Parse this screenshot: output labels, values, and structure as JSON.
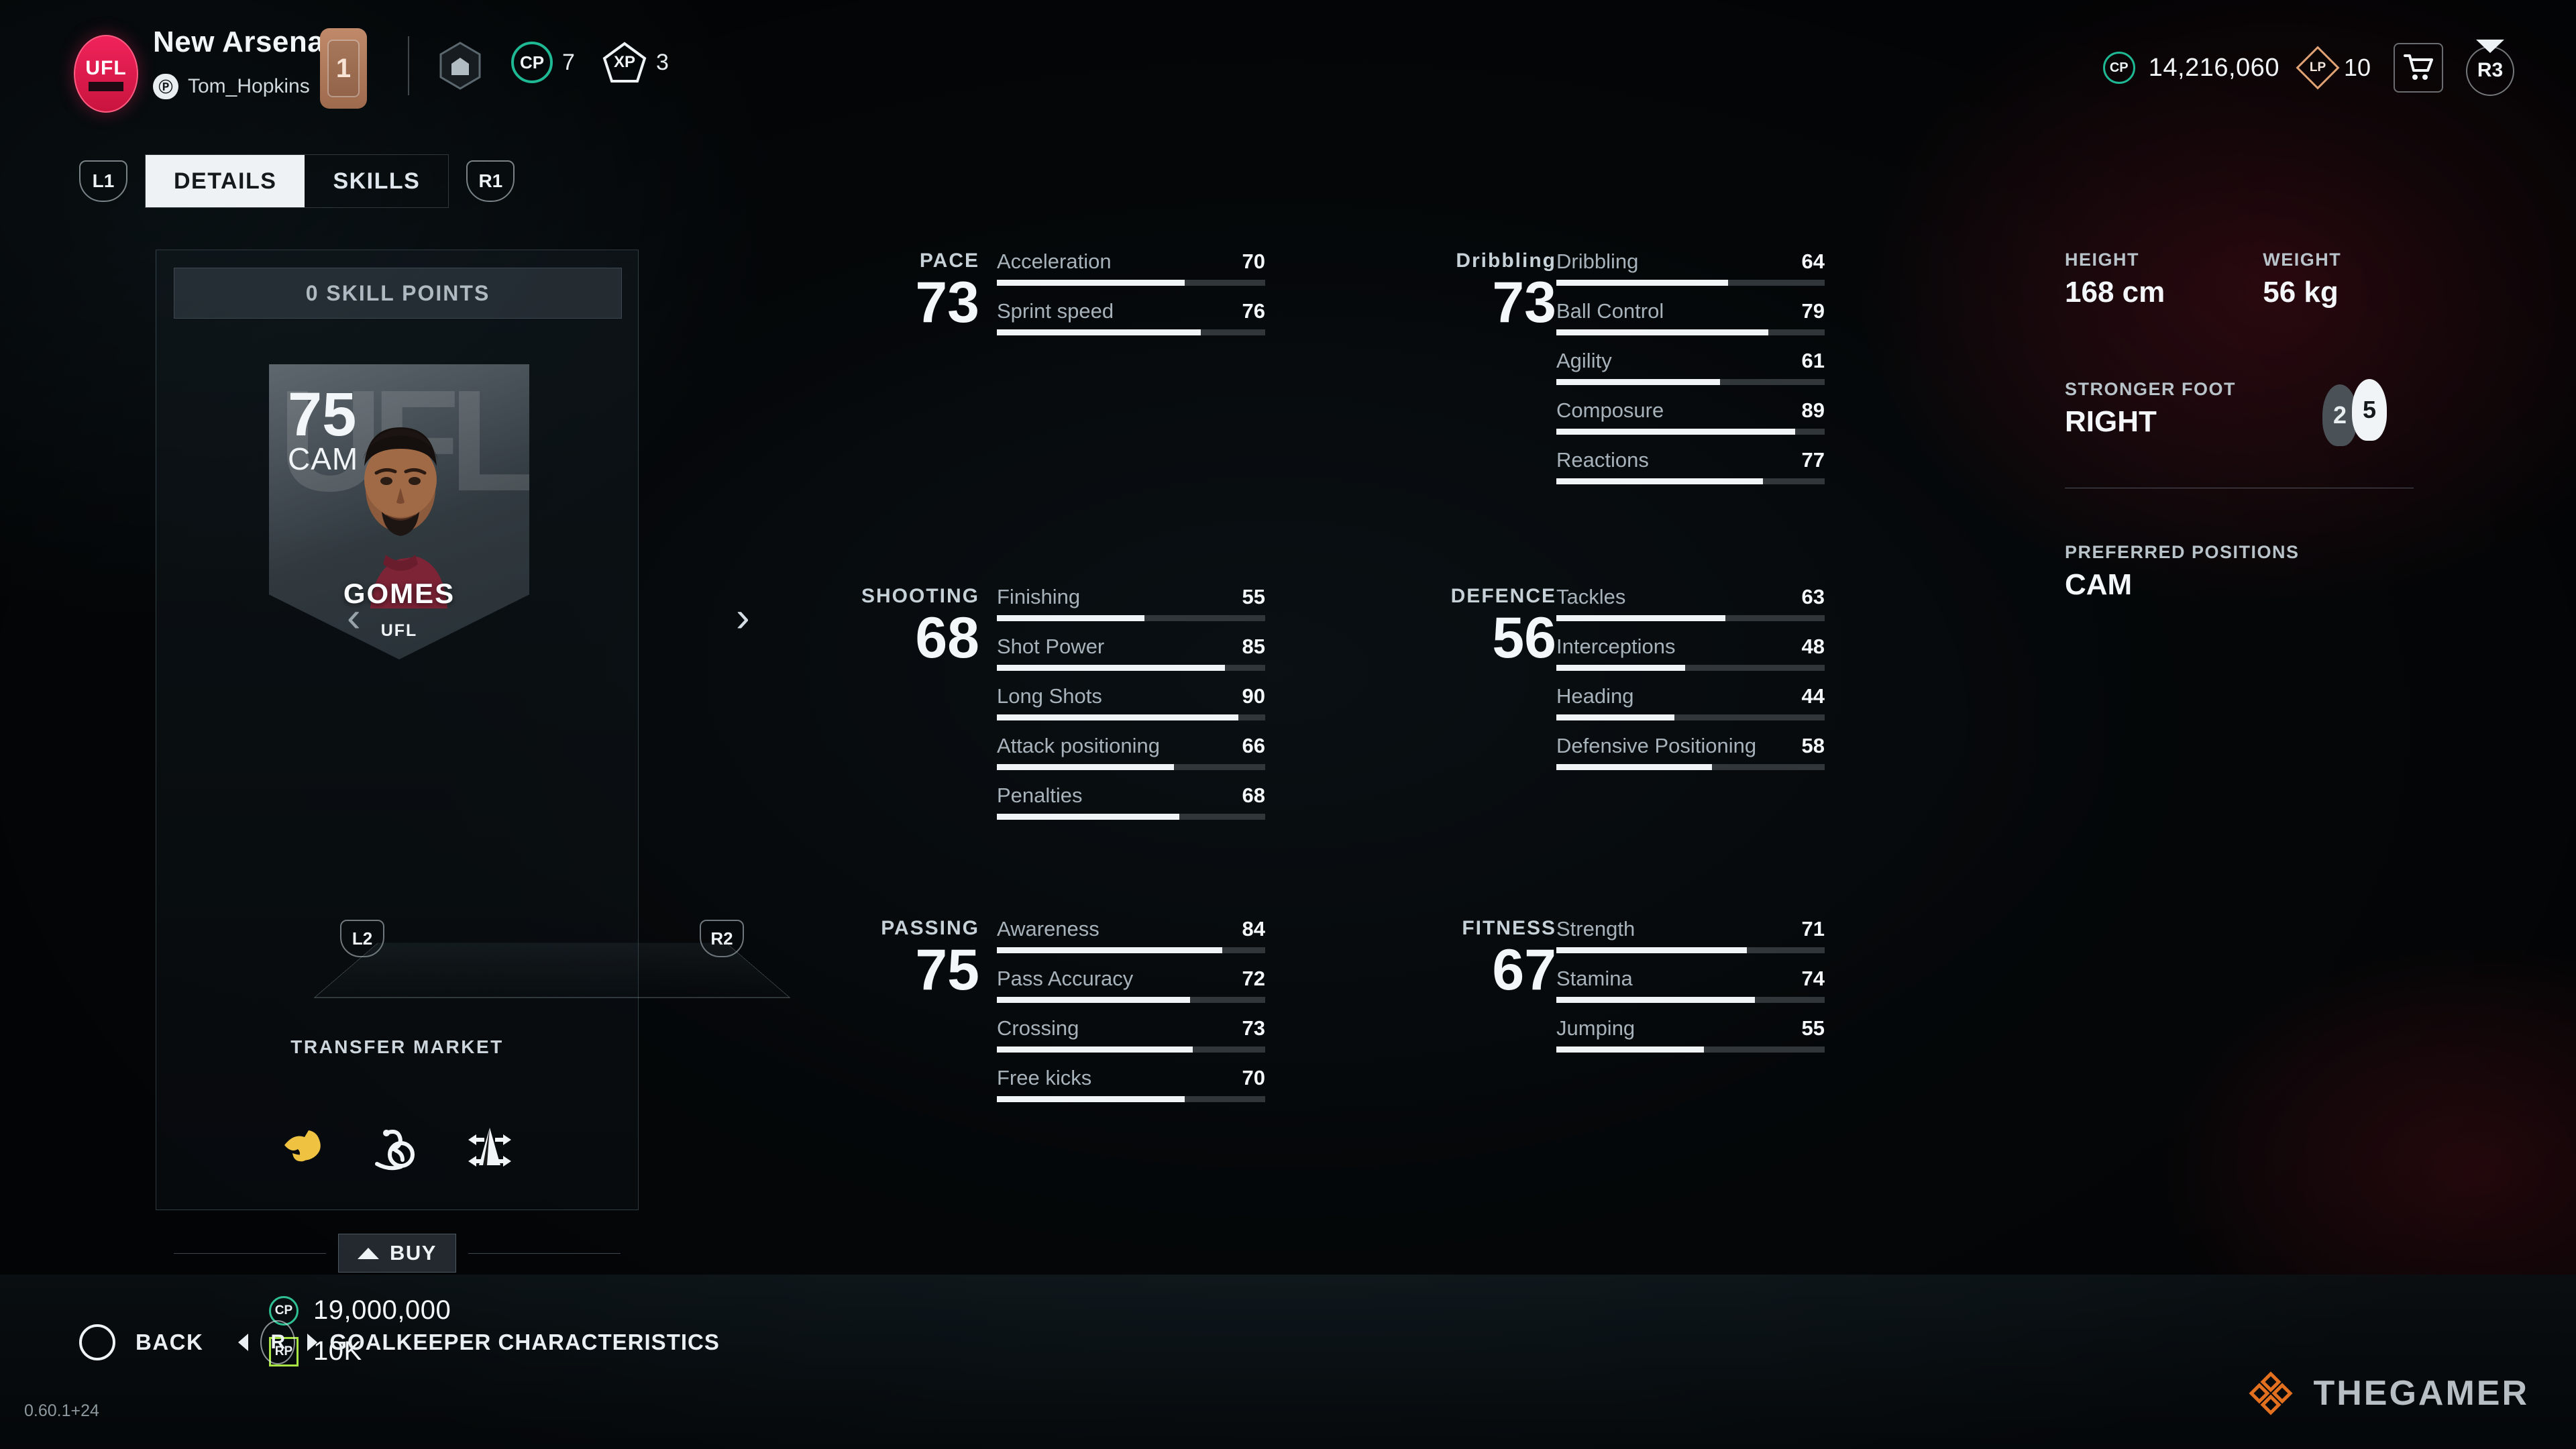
{
  "header": {
    "club_crest_text": "UFL",
    "team_name": "New Arsenal",
    "platform_icon": "playstation-icon",
    "user_name": "Tom_Hopkins",
    "level": "1",
    "division_icon": "hexagon-rank-icon",
    "cp_mini_label": "CP",
    "cp_mini_value": "7",
    "xp_mini_label": "XP",
    "xp_mini_value": "3",
    "cp_total_label": "CP",
    "cp_total_value": "14,216,060",
    "lp_label": "LP",
    "lp_value": "10",
    "cart_icon": "shopping-cart-icon",
    "r3_label": "R3"
  },
  "tabs": {
    "left_bumper": "L1",
    "right_bumper": "R1",
    "items": [
      {
        "label": "DETAILS",
        "active": true
      },
      {
        "label": "SKILLS",
        "active": false
      }
    ]
  },
  "card": {
    "skill_points": "0 SKILL POINTS",
    "rating": "75",
    "position": "CAM",
    "player_name": "GOMES",
    "brand": "UFL",
    "prev_arrow": "‹",
    "next_arrow": "›",
    "left_trigger": "L2",
    "right_trigger": "R2",
    "market_label": "TRANSFER MARKET",
    "traits": [
      {
        "name": "strength-trait-icon",
        "color": "#efc341"
      },
      {
        "name": "shot-curve-trait-icon",
        "color": "#f2f5f7"
      },
      {
        "name": "agility-trait-icon",
        "color": "#f2f5f7"
      }
    ],
    "buy_label": "BUY",
    "prices": [
      {
        "currency": "CP",
        "value": "19,000,000",
        "color": "#2fbf90"
      },
      {
        "currency": "RP",
        "value": "10K",
        "color": "#a9e545"
      }
    ]
  },
  "stats": {
    "groups": [
      {
        "label": "PACE",
        "value": "73",
        "rows": [
          {
            "name": "Acceleration",
            "value": 70
          },
          {
            "name": "Sprint speed",
            "value": 76
          }
        ]
      },
      {
        "label": "SHOOTING",
        "value": "68",
        "rows": [
          {
            "name": "Finishing",
            "value": 55
          },
          {
            "name": "Shot Power",
            "value": 85
          },
          {
            "name": "Long Shots",
            "value": 90
          },
          {
            "name": "Attack positioning",
            "value": 66
          },
          {
            "name": "Penalties",
            "value": 68
          }
        ]
      },
      {
        "label": "PASSING",
        "value": "75",
        "rows": [
          {
            "name": "Awareness",
            "value": 84
          },
          {
            "name": "Pass Accuracy",
            "value": 72
          },
          {
            "name": "Crossing",
            "value": 73
          },
          {
            "name": "Free kicks",
            "value": 70
          }
        ]
      },
      {
        "label": "Dribbling",
        "value": "73",
        "rows": [
          {
            "name": "Dribbling",
            "value": 64
          },
          {
            "name": "Ball Control",
            "value": 79
          },
          {
            "name": "Agility",
            "value": 61
          },
          {
            "name": "Composure",
            "value": 89
          },
          {
            "name": "Reactions",
            "value": 77
          }
        ]
      },
      {
        "label": "DEFENCE",
        "value": "56",
        "rows": [
          {
            "name": "Tackles",
            "value": 63
          },
          {
            "name": "Interceptions",
            "value": 48
          },
          {
            "name": "Heading",
            "value": 44
          },
          {
            "name": "Defensive Positioning",
            "value": 58
          }
        ]
      },
      {
        "label": "FITNESS",
        "value": "67",
        "rows": [
          {
            "name": "Strength",
            "value": 71
          },
          {
            "name": "Stamina",
            "value": 74
          },
          {
            "name": "Jumping",
            "value": 55
          }
        ]
      }
    ]
  },
  "info": {
    "height_label": "HEIGHT",
    "height_value": "168 cm",
    "weight_label": "WEIGHT",
    "weight_value": "56 kg",
    "foot_label": "STRONGER FOOT",
    "foot_value": "RIGHT",
    "weak_foot_rating": "2",
    "strong_foot_rating": "5",
    "positions_label": "PREFERRED POSITIONS",
    "positions_value": "CAM"
  },
  "bottom": {
    "back_button_icon": "circle-button-icon",
    "back_label": "BACK",
    "r_button": "R",
    "gk_label": "GOALKEEPER CHARACTERISTICS",
    "version": "0.60.1+24",
    "watermark": "THEGAMER"
  }
}
